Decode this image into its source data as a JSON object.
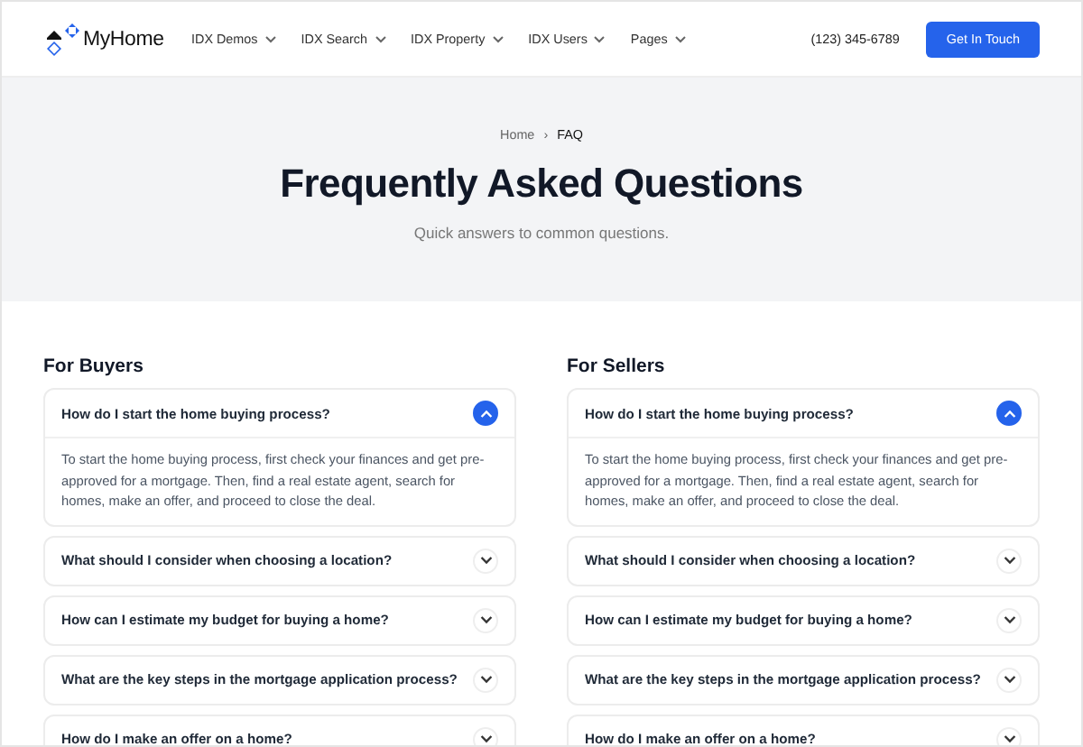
{
  "header": {
    "logo": "MyHome",
    "nav": [
      {
        "label": "IDX Demos"
      },
      {
        "label": "IDX Search"
      },
      {
        "label": "IDX Property"
      },
      {
        "label": "IDX Users"
      },
      {
        "label": "Pages"
      }
    ],
    "phone": "(123) 345-6789",
    "cta": "Get In Touch"
  },
  "hero": {
    "breadcrumb": [
      "Home",
      "FAQ"
    ],
    "separator": "›",
    "title": "Frequently Asked Questions",
    "subtitle": "Quick answers to common questions."
  },
  "sections": [
    {
      "title": "For Buyers",
      "items": [
        {
          "question": "How do I start the home buying process?",
          "expanded": true,
          "answer": "To start the home buying process, first check your finances and get pre-approved for a mortgage. Then, find a real estate agent, search for homes, make an offer, and proceed to close the deal."
        },
        {
          "question": "What should I consider when choosing a location?",
          "expanded": false
        },
        {
          "question": "How can I estimate my budget for buying a home?",
          "expanded": false
        },
        {
          "question": "What are the key steps in the mortgage application process?",
          "expanded": false
        },
        {
          "question": "How do I make an offer on a home?",
          "expanded": false
        }
      ]
    },
    {
      "title": "For Sellers",
      "items": [
        {
          "question": "How do I start the home buying process?",
          "expanded": true,
          "answer": "To start the home buying process, first check your finances and get pre-approved for a mortgage. Then, find a real estate agent, search for homes, make an offer, and proceed to close the deal."
        },
        {
          "question": "What should I consider when choosing a location?",
          "expanded": false
        },
        {
          "question": "How can I estimate my budget for buying a home?",
          "expanded": false
        },
        {
          "question": "What are the key steps in the mortgage application process?",
          "expanded": false
        },
        {
          "question": "How do I make an offer on a home?",
          "expanded": false
        }
      ]
    }
  ]
}
